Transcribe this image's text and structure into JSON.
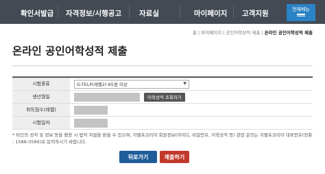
{
  "nav": {
    "items": [
      {
        "label": "확인서발급"
      },
      {
        "label": "자격정보/시행공고"
      },
      {
        "label": "자료실"
      },
      {
        "label": "마이페이지"
      },
      {
        "label": "고객지원"
      }
    ],
    "all_menu_label": "전체메뉴"
  },
  "breadcrumb": {
    "home": "홈",
    "sep": "|",
    "level1": "마이페이지",
    "level2": "공인어학성적 제출",
    "current": "온라인 공인어학성적 제출"
  },
  "page_title": "온라인 공인어학성적 제출",
  "form": {
    "exam_type_label": "시험종류",
    "exam_type_value": "G-TELP(레벨2) 65점 이상",
    "birth_label": "생년월일",
    "score_lookup_button": "어학성적 조회하기",
    "score_label": "취득점수(레벨)",
    "exam_date_label": "시험일자"
  },
  "notice": "* 타인의 성적 및 정보 등을 활용 시 법적 처벌을 받을 수 있으며, 지텔프코리아 회원정보(아이디, 비밀번호, 어학성적 등) 관련 문의는 지텔프코리아 대표번호(전화 : 1588-0589)로 문의하시기 바랍니다.",
  "buttons": {
    "back": "뒤로가기",
    "submit": "제출하기"
  },
  "colors": {
    "nav_bg": "#434a54",
    "all_menu_bg": "#2b83c5",
    "back_button": "#1f5c9a",
    "submit_button": "#c0392b"
  }
}
